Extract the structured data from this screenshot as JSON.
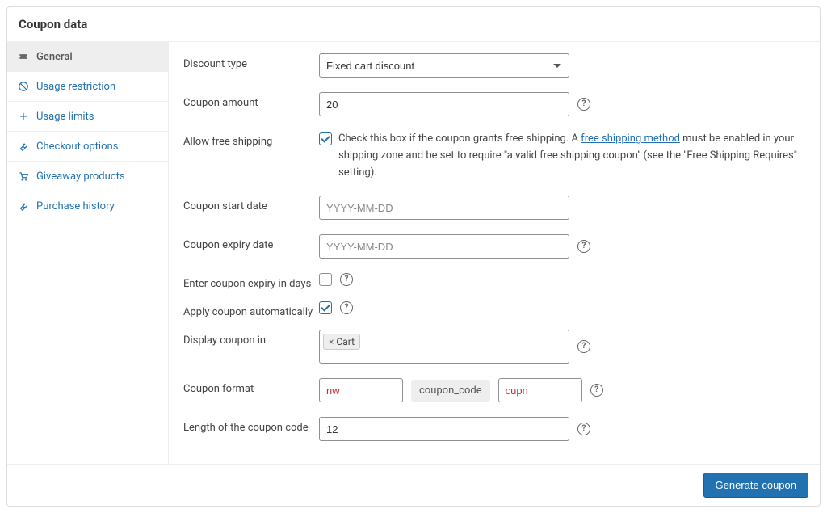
{
  "panel": {
    "title": "Coupon data"
  },
  "sidebar": {
    "items": [
      {
        "label": "General"
      },
      {
        "label": "Usage restriction"
      },
      {
        "label": "Usage limits"
      },
      {
        "label": "Checkout options"
      },
      {
        "label": "Giveaway products"
      },
      {
        "label": "Purchase history"
      }
    ]
  },
  "form": {
    "discount_type": {
      "label": "Discount type",
      "value": "Fixed cart discount"
    },
    "coupon_amount": {
      "label": "Coupon amount",
      "value": "20"
    },
    "free_shipping": {
      "label": "Allow free shipping",
      "desc_pre": "Check this box if the coupon grants free shipping. A ",
      "link_text": "free shipping method",
      "desc_post": " must be enabled in your shipping zone and be set to require \"a valid free shipping coupon\" (see the \"Free Shipping Requires\" setting)."
    },
    "start_date": {
      "label": "Coupon start date",
      "placeholder": "YYYY-MM-DD"
    },
    "expiry_date": {
      "label": "Coupon expiry date",
      "placeholder": "YYYY-MM-DD"
    },
    "expiry_days": {
      "label": "Enter coupon expiry in days"
    },
    "apply_auto": {
      "label": "Apply coupon automatically"
    },
    "display_in": {
      "label": "Display coupon in",
      "tag": "Cart"
    },
    "coupon_format": {
      "label": "Coupon format",
      "prefix": "nw",
      "token": "coupon_code",
      "suffix": "cupn"
    },
    "code_length": {
      "label": "Length of the coupon code",
      "value": "12"
    }
  },
  "footer": {
    "generate": "Generate coupon"
  }
}
